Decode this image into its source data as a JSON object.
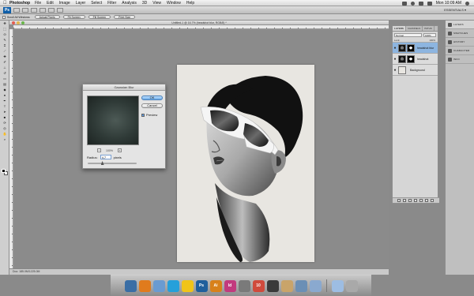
{
  "menubar": {
    "app_name": "Photoshop",
    "items": [
      "File",
      "Edit",
      "Image",
      "Layer",
      "Select",
      "Filter",
      "Analysis",
      "3D",
      "View",
      "Window",
      "Help"
    ],
    "clock": "Mon 10:09 AM"
  },
  "appbar": {
    "logo": "Ps",
    "workspace": "ESSENTIALS ▾"
  },
  "options_bar": {
    "scroll_all_label": "Scroll All Windows",
    "buttons": [
      "Actual Pixels",
      "Fit Screen",
      "Fill Screen",
      "Print Size"
    ]
  },
  "document": {
    "title": "Untitled-1 @ 16.7% (headshot blur, RGB/8) *",
    "status": "Doc: 185.0M/1225.0M"
  },
  "gaussian_blur": {
    "title": "Gaussian Blur",
    "ok_label": "OK",
    "cancel_label": "Cancel",
    "preview_label": "Preview",
    "zoom_label": "100%",
    "radius_label": "Radius:",
    "radius_value": "4.7",
    "units": "pixels",
    "radius_fraction": 0.3
  },
  "layers_panel": {
    "tabs": [
      "LAYERS",
      "CHANNELS",
      "PATHS"
    ],
    "blend_mode": "Normal",
    "opacity": "100%",
    "lock_label": "Lock:",
    "fill": "100%",
    "layers": [
      {
        "name": "headshot blur",
        "selected": true
      },
      {
        "name": "headshot",
        "selected": false
      },
      {
        "name": "Background",
        "selected": false
      }
    ]
  },
  "right_dock": {
    "items": [
      "LAYERS",
      "SWATCHES",
      "HISTORY",
      "CHARACTER",
      "INFO"
    ]
  },
  "dock": {
    "apps": [
      {
        "label": "",
        "color": "#3a6ea5"
      },
      {
        "label": "",
        "color": "#e07b1d"
      },
      {
        "label": "",
        "color": "#6a9bd1"
      },
      {
        "label": "",
        "color": "#25a0da"
      },
      {
        "label": "",
        "color": "#f0c419"
      },
      {
        "label": "Ps",
        "color": "#1f5f9c"
      },
      {
        "label": "Ai",
        "color": "#d8811a"
      },
      {
        "label": "Id",
        "color": "#c23a7e"
      },
      {
        "label": "",
        "color": "#7a7a7a"
      },
      {
        "label": "10",
        "color": "#d04a3c"
      },
      {
        "label": "",
        "color": "#3a3a3a"
      },
      {
        "label": "",
        "color": "#c9a46a"
      },
      {
        "label": "",
        "color": "#6b8fb5"
      },
      {
        "label": "",
        "color": "#8aa9cf"
      },
      {
        "label": "",
        "color": "#9dbde3"
      },
      {
        "label": "",
        "color": "#a9a9a9"
      }
    ]
  }
}
